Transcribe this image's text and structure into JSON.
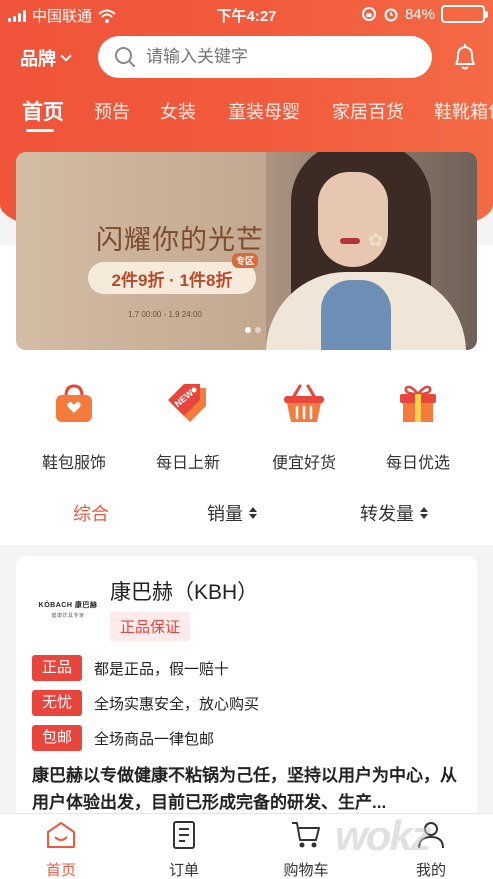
{
  "status_bar": {
    "carrier": "中国联通",
    "time": "下午4:27",
    "battery_percent": "84%",
    "battery_level": 0.84
  },
  "header": {
    "brand_label": "品牌",
    "search_placeholder": "请输入关键字"
  },
  "tabs": [
    {
      "label": "首页"
    },
    {
      "label": "预告"
    },
    {
      "label": "女装"
    },
    {
      "label": "童装母婴"
    },
    {
      "label": "家居百货"
    },
    {
      "label": "鞋靴箱包"
    }
  ],
  "banner": {
    "title": "闪耀你的光芒",
    "promo": "2件9折 · 1件8折",
    "zone_tag": "专区",
    "date_range": "1.7 00:00 - 1.9 24:00"
  },
  "categories": [
    {
      "label": "鞋包服饰",
      "icon": "handbag-icon"
    },
    {
      "label": "每日上新",
      "icon": "new-tag-icon"
    },
    {
      "label": "便宜好货",
      "icon": "basket-icon"
    },
    {
      "label": "每日优选",
      "icon": "gift-icon"
    }
  ],
  "sort_bar": {
    "comprehensive": "综合",
    "sales": "销量",
    "shares": "转发量"
  },
  "store": {
    "logo_text": "KÖBACH 康巴赫",
    "logo_subtext": "健康炊具专家",
    "name": "康巴赫（KBH）",
    "guarantee": "正品保证",
    "features": [
      {
        "tag": "正品",
        "text": "都是正品，假一赔十"
      },
      {
        "tag": "无忧",
        "text": "全场实惠安全，放心购买"
      },
      {
        "tag": "包邮",
        "text": "全场商品一律包邮"
      }
    ],
    "description": "康巴赫以专做健康不粘锅为己任，坚持以用户为中心，从用户体验出发，目前已形成完备的研发、生产..."
  },
  "bottom_nav": [
    {
      "label": "首页"
    },
    {
      "label": "订单"
    },
    {
      "label": "购物车"
    },
    {
      "label": "我的"
    }
  ],
  "watermark": "wokz",
  "colors": {
    "accent": "#f05a3c",
    "tag_red": "#e8453c"
  }
}
